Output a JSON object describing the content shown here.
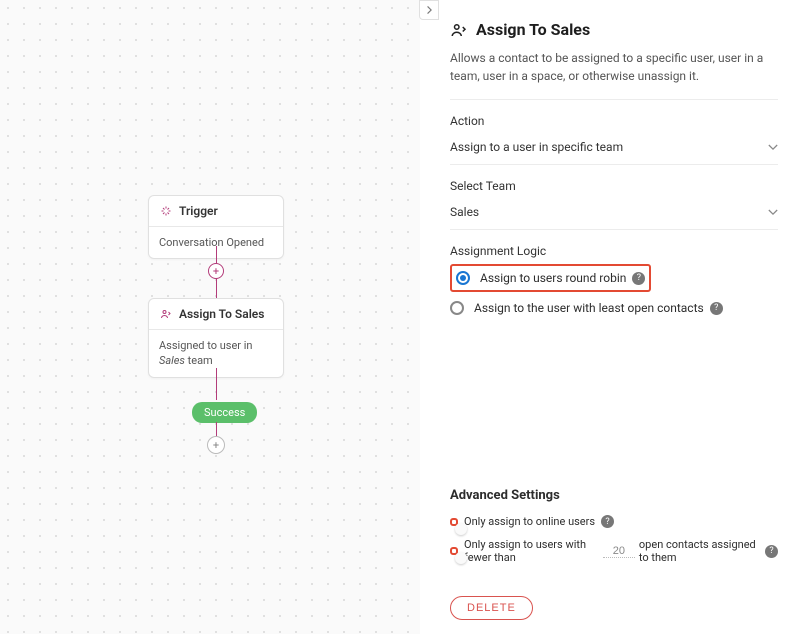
{
  "canvas": {
    "trigger": {
      "title": "Trigger",
      "body": "Conversation Opened"
    },
    "assign": {
      "title": "Assign To Sales",
      "body_prefix": "Assigned to user in ",
      "body_em": "Sales",
      "body_suffix": " team"
    },
    "success_label": "Success"
  },
  "panel": {
    "title": "Assign To Sales",
    "description": "Allows a contact to be assigned to a specific user, user in a team, user in a space, or otherwise unassign it.",
    "action_label": "Action",
    "action_value": "Assign to a user in specific team",
    "team_label": "Select Team",
    "team_value": "Sales",
    "logic_label": "Assignment Logic",
    "logic_options": {
      "round_robin": "Assign to users round robin",
      "least_open": "Assign to the user with least open contacts"
    },
    "advanced": {
      "heading": "Advanced Settings",
      "online_only": "Only assign to online users",
      "fewer_prefix": "Only assign to users with fewer than",
      "fewer_value": "20",
      "fewer_suffix": "open contacts assigned to them"
    },
    "delete": "DELETE"
  }
}
